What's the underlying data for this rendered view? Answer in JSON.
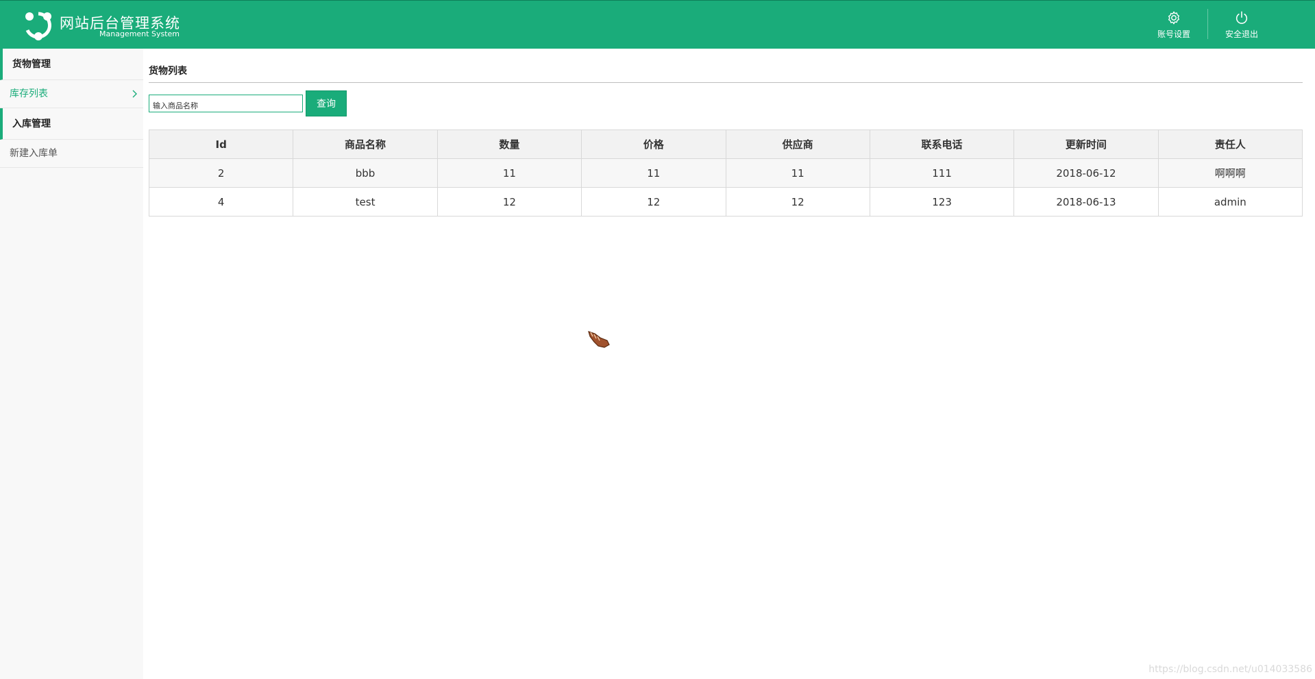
{
  "header": {
    "title": "网站后台管理系统",
    "subtitle": "Management System",
    "account_settings_label": "账号设置",
    "logout_label": "安全退出",
    "bg_color": "#1aac7a"
  },
  "sidebar": {
    "groups": [
      {
        "label": "货物管理",
        "items": [
          {
            "label": "库存列表",
            "active": true
          }
        ]
      },
      {
        "label": "入库管理",
        "items": [
          {
            "label": "新建入库单",
            "active": false
          }
        ]
      }
    ]
  },
  "main": {
    "title": "货物列表",
    "search": {
      "placeholder": "输入商品名称",
      "button_label": "查询"
    },
    "table": {
      "columns": [
        "Id",
        "商品名称",
        "数量",
        "价格",
        "供应商",
        "联系电话",
        "更新时间",
        "责任人"
      ],
      "rows": [
        [
          "2",
          "bbb",
          "11",
          "11",
          "11",
          "111",
          "2018-06-12",
          "啊啊啊"
        ],
        [
          "4",
          "test",
          "12",
          "12",
          "12",
          "123",
          "2018-06-13",
          "admin"
        ]
      ]
    }
  },
  "watermark": "https://blog.csdn.net/u014033586",
  "icons": {
    "logo": "logo-icon",
    "settings": "gear-icon",
    "logout": "power-icon",
    "chevron": "chevron-right-icon",
    "cursor": "hand-cursor-icon"
  }
}
